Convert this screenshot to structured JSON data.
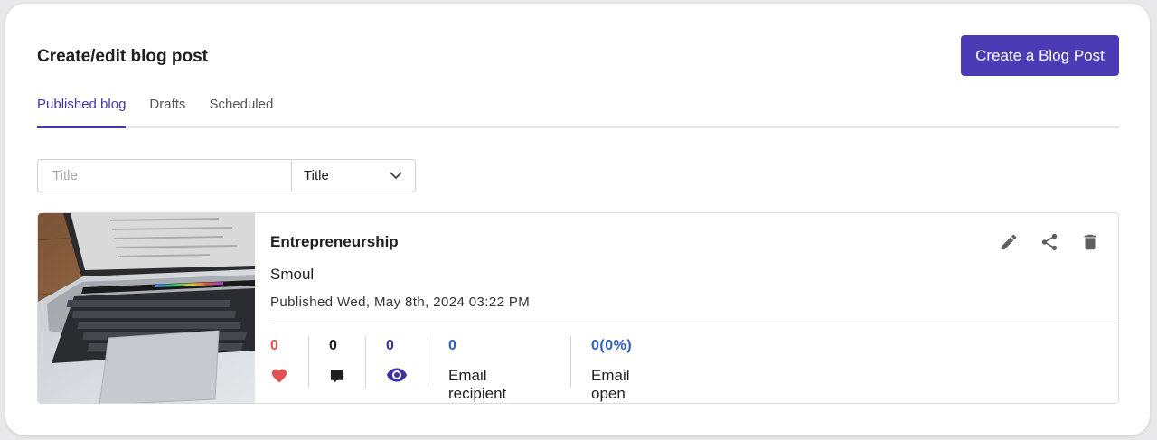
{
  "header": {
    "title": "Create/edit blog post",
    "create_button": "Create a Blog Post"
  },
  "tabs": [
    {
      "label": "Published blog",
      "active": true
    },
    {
      "label": "Drafts",
      "active": false
    },
    {
      "label": "Scheduled",
      "active": false
    }
  ],
  "filter": {
    "search_placeholder": "Title",
    "search_value": "",
    "field_select": "Title"
  },
  "posts": [
    {
      "title": "Entrepreneurship",
      "author": "Smoul",
      "published": "Published Wed, May 8th, 2024 03:22 PM",
      "likes": "0",
      "comments": "0",
      "views": "0",
      "email_recipient_value": "0",
      "email_recipient_label": "Email recipient",
      "email_open_rate_value": "0(0%)",
      "email_open_rate_label": "Email open rate(%)"
    }
  ],
  "colors": {
    "accent": "#4b3bb5",
    "like": "#e05252",
    "link_blue": "#2d5fc0",
    "views": "#3e2fa3"
  },
  "icons": [
    "chevron-down-icon",
    "edit-icon",
    "share-icon",
    "delete-icon",
    "heart-icon",
    "comment-icon",
    "eye-icon"
  ]
}
